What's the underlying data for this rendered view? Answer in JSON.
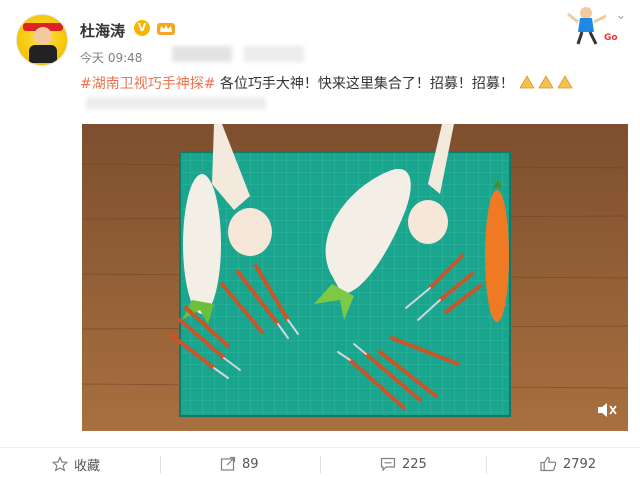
{
  "user": {
    "name": "杜海涛",
    "verified_mark": "V",
    "time": "今天 09:48"
  },
  "post": {
    "hashtag": "#湖南卫视巧手神探#",
    "text": " 各位巧手大神！快来这里集合了！招募！招募！"
  },
  "actions": {
    "favorite_label": "收藏",
    "repost_count": "89",
    "comment_count": "225",
    "like_count": "2792"
  },
  "colors": {
    "hashtag": "#eb7350",
    "mat": "#1aa58f",
    "table": "#9b6338"
  }
}
